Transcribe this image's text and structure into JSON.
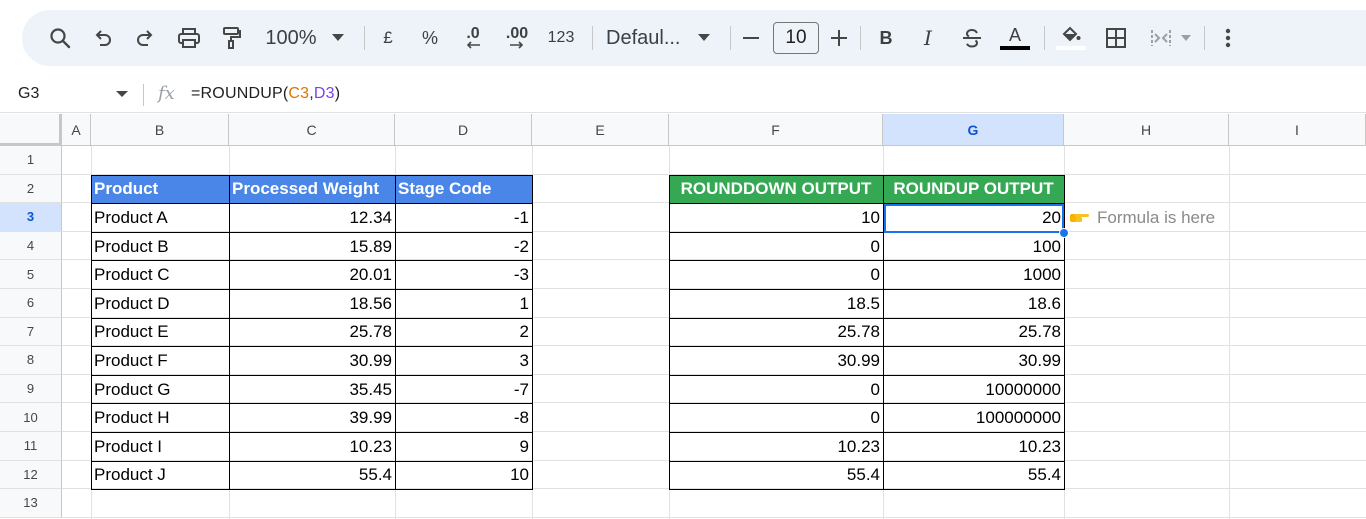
{
  "toolbar": {
    "zoom": "100%",
    "currency": "£",
    "percent": "%",
    "decrease_decimal": ".0",
    "increase_decimal": ".00",
    "number_format": "123",
    "font": "Defaul...",
    "font_size": "10",
    "bold": "B",
    "italic": "I",
    "text_color": "A"
  },
  "formula_bar": {
    "cell_ref": "G3",
    "formula_prefix": "=ROUNDUP(",
    "ref1": "C3",
    "comma": ",",
    "ref2": "D3",
    "formula_suffix": ")"
  },
  "columns": [
    "A",
    "B",
    "C",
    "D",
    "E",
    "F",
    "G",
    "H",
    "I"
  ],
  "rows": [
    "1",
    "2",
    "3",
    "4",
    "5",
    "6",
    "7",
    "8",
    "9",
    "10",
    "11",
    "12",
    "13"
  ],
  "left_table": {
    "headers": [
      "Product",
      "Processed Weight",
      "Stage Code"
    ],
    "rows": [
      [
        "Product A",
        "12.34",
        "-1"
      ],
      [
        "Product B",
        "15.89",
        "-2"
      ],
      [
        "Product C",
        "20.01",
        "-3"
      ],
      [
        "Product D",
        "18.56",
        "1"
      ],
      [
        "Product E",
        "25.78",
        "2"
      ],
      [
        "Product F",
        "30.99",
        "3"
      ],
      [
        "Product G",
        "35.45",
        "-7"
      ],
      [
        "Product H",
        "39.99",
        "-8"
      ],
      [
        "Product I",
        "10.23",
        "9"
      ],
      [
        "Product J",
        "55.4",
        "10"
      ]
    ]
  },
  "right_table": {
    "headers": [
      "ROUNDDOWN OUTPUT",
      "ROUNDUP OUTPUT"
    ],
    "rows": [
      [
        "10",
        "20"
      ],
      [
        "0",
        "100"
      ],
      [
        "0",
        "1000"
      ],
      [
        "18.5",
        "18.6"
      ],
      [
        "25.78",
        "25.78"
      ],
      [
        "30.99",
        "30.99"
      ],
      [
        "0",
        "10000000"
      ],
      [
        "0",
        "100000000"
      ],
      [
        "10.23",
        "10.23"
      ],
      [
        "55.4",
        "55.4"
      ]
    ]
  },
  "annotation": "Formula is here",
  "selected_cell": "G3",
  "colors": {
    "header_blue": "#4a86e8",
    "header_green": "#34a853",
    "selection": "#1a73e8"
  }
}
